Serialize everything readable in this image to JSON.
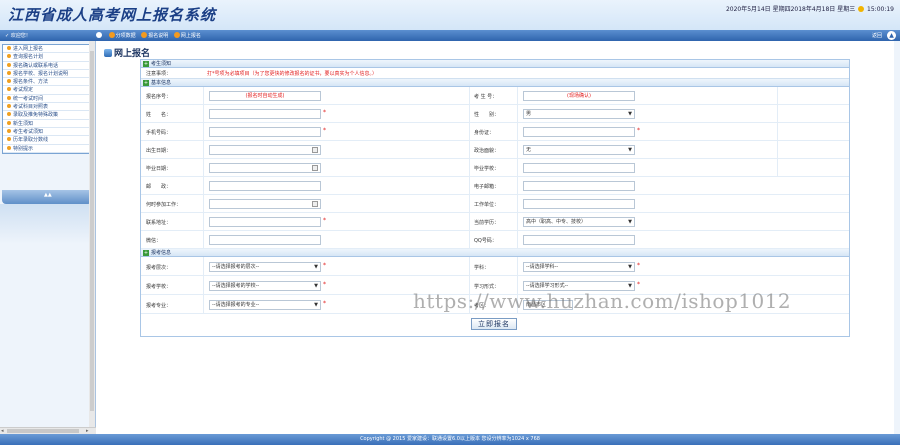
{
  "header": {
    "logo": "江西省成人高考网上报名系统",
    "date": "2020年5月14日 星期四2018年4月18日 星期三",
    "clock": "15:00:19"
  },
  "navbar": {
    "user": "欢迎您！",
    "links": [
      "分项数据",
      "报名说明",
      "网上报名"
    ],
    "back": "返回"
  },
  "sidebar": {
    "items": [
      "进入网上报名",
      "查询报名计划",
      "报名确认或联系电话",
      "报名学校、报名计划说明",
      "报名条件、方法",
      "考试规定",
      "统一考试时间",
      "考试科目对照表",
      "录取及推免特殊政策",
      "新生须知",
      "考生考试须知",
      "历年录取分数线",
      "特别提示"
    ]
  },
  "page": {
    "title": "网上报名",
    "section_notice": "考生须知",
    "notice_label": "注意事项：",
    "notice_text": "打*号项为必填项目（为了您更快的修改报名的证书，要以真实为个人信息。）",
    "section_basic": "基本信息",
    "section_apply": "报考信息",
    "submit": "立即报名"
  },
  "basic": {
    "exam_no_label": "报名序号：",
    "exam_no_value": "(报名时自动生成)",
    "candidate_no_label": "考 生 号：",
    "candidate_no_value": "(现场确认)",
    "name_label": "姓　　名：",
    "gender_label": "性　　别：",
    "gender_value": "男",
    "phone_label": "手机号码：",
    "id_label": "身份证：",
    "birth_label": "出生日期：",
    "politics_label": "政治面貌：",
    "politics_value": "无",
    "grad_date_label": "毕业日期：",
    "grad_school_label": "毕业学校：",
    "zip_label": "邮　　政：",
    "email_label": "电子邮箱：",
    "work_date_label": "何时参加工作：",
    "work_unit_label": "工作单位：",
    "address_label": "联系地址：",
    "edu_label": "当前学历：",
    "edu_value": "高中（职高、中专、技校）",
    "wechat_label": "微信：",
    "qq_label": "QQ号码："
  },
  "apply": {
    "level_label": "报考层次：",
    "level_value": "--请选择报考的层次--",
    "category_label": "学科：",
    "category_value": "--请选择学科--",
    "school_label": "报考学校：",
    "school_value": "--请选择报考的学校--",
    "mode_label": "学习形式：",
    "mode_value": "--请选择学习形式--",
    "major_label": "报考专业：",
    "major_value": "--请选择报考的专业--",
    "site_label": "考区：",
    "site_value": "南昌市区"
  },
  "watermark": "https://www.huzhan.com/ishop1012",
  "footer": "Copyright @ 2015 爱家建设：联通设置6.0以上版本 您设分辨率为1024 x 768"
}
